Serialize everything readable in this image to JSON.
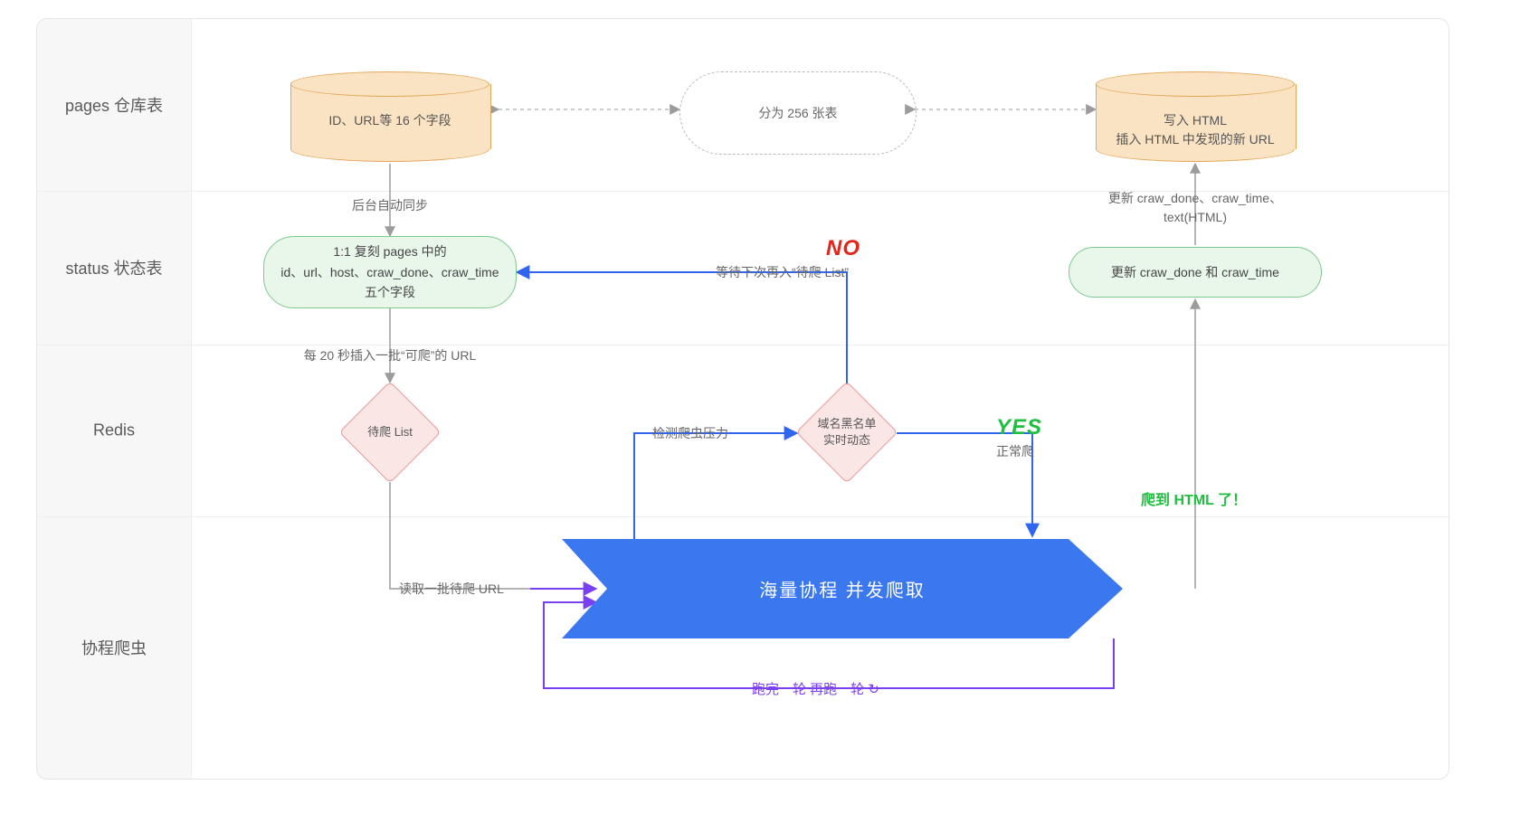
{
  "lanes": {
    "pages": "pages 仓库表",
    "status": "status 状态表",
    "redis": "Redis",
    "crawler": "协程爬虫"
  },
  "nodes": {
    "cyl_left": "ID、URL等 16 个字段",
    "cloud": "分为 256 张表",
    "cyl_right_l1": "写入 HTML",
    "cyl_right_l2": "插入 HTML 中发现的新 URL",
    "cap_left_l1": "1:1 复刻 pages 中的",
    "cap_left_l2": "id、url、host、craw_done、craw_time",
    "cap_left_l3": "五个字段",
    "cap_right": "更新 craw_done 和 craw_time",
    "diamond_left": "待爬 List",
    "diamond_right_l1": "域名黑名单",
    "diamond_right_l2": "实时动态",
    "bigarrow": "海量协程  并发爬取"
  },
  "edges": {
    "sync": "后台自动同步",
    "insert": "每 20 秒插入一批“可爬”的 URL",
    "read": "读取一批待爬 URL",
    "pressure": "检测爬虫压力",
    "normal": "正常爬",
    "wait": "等待下次再入“待爬 List”",
    "update_done": "更新 craw_done、craw_time、\ntext(HTML)",
    "got_html": "爬到 HTML 了！",
    "loop": "跑完一轮 再跑一轮"
  },
  "labels": {
    "no": "NO",
    "yes": "YES"
  },
  "colors": {
    "blue": "#3065f0",
    "purple": "#7b3ff2",
    "grey": "#9b9b9b",
    "green": "#1fbf3f",
    "red": "#e1251b"
  }
}
